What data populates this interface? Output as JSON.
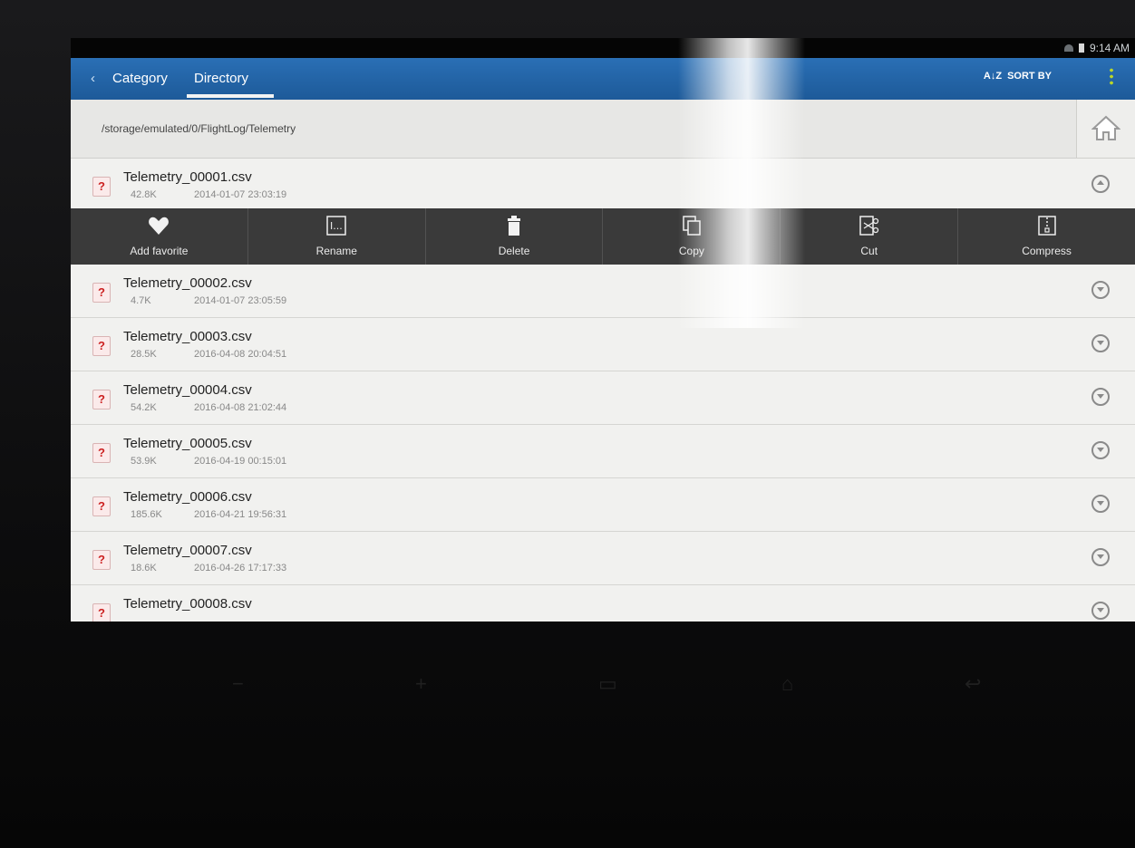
{
  "status_bar": {
    "time": "9:14 AM"
  },
  "app_bar": {
    "back_glyph": "‹",
    "tabs": [
      {
        "label": "Category",
        "active": false
      },
      {
        "label": "Directory",
        "active": true
      }
    ],
    "sort_label": "SORT BY",
    "sort_glyph": "A↓Z"
  },
  "path_bar": {
    "path": "/storage/emulated/0/FlightLog/Telemetry"
  },
  "files": [
    {
      "name": "Telemetry_00001.csv",
      "size": "42.8K",
      "date": "2014-01-07 23:03:19",
      "expanded": true
    },
    {
      "name": "Telemetry_00002.csv",
      "size": "4.7K",
      "date": "2014-01-07 23:05:59"
    },
    {
      "name": "Telemetry_00003.csv",
      "size": "28.5K",
      "date": "2016-04-08 20:04:51"
    },
    {
      "name": "Telemetry_00004.csv",
      "size": "54.2K",
      "date": "2016-04-08 21:02:44"
    },
    {
      "name": "Telemetry_00005.csv",
      "size": "53.9K",
      "date": "2016-04-19 00:15:01"
    },
    {
      "name": "Telemetry_00006.csv",
      "size": "185.6K",
      "date": "2016-04-21 19:56:31"
    },
    {
      "name": "Telemetry_00007.csv",
      "size": "18.6K",
      "date": "2016-04-26 17:17:33"
    },
    {
      "name": "Telemetry_00008.csv",
      "size": "",
      "date": ""
    }
  ],
  "file_icon_glyph": "?",
  "actions": [
    {
      "label": "Add favorite",
      "icon": "heart-icon"
    },
    {
      "label": "Rename",
      "icon": "rename-icon"
    },
    {
      "label": "Delete",
      "icon": "trash-icon"
    },
    {
      "label": "Copy",
      "icon": "copy-icon"
    },
    {
      "label": "Cut",
      "icon": "scissors-icon"
    },
    {
      "label": "Compress",
      "icon": "zip-icon"
    }
  ],
  "colors": {
    "app_bar": "#1d5a99",
    "action_bar": "#3a3a3a",
    "list_bg": "#f1f1ef",
    "file_icon": "#c22222"
  }
}
